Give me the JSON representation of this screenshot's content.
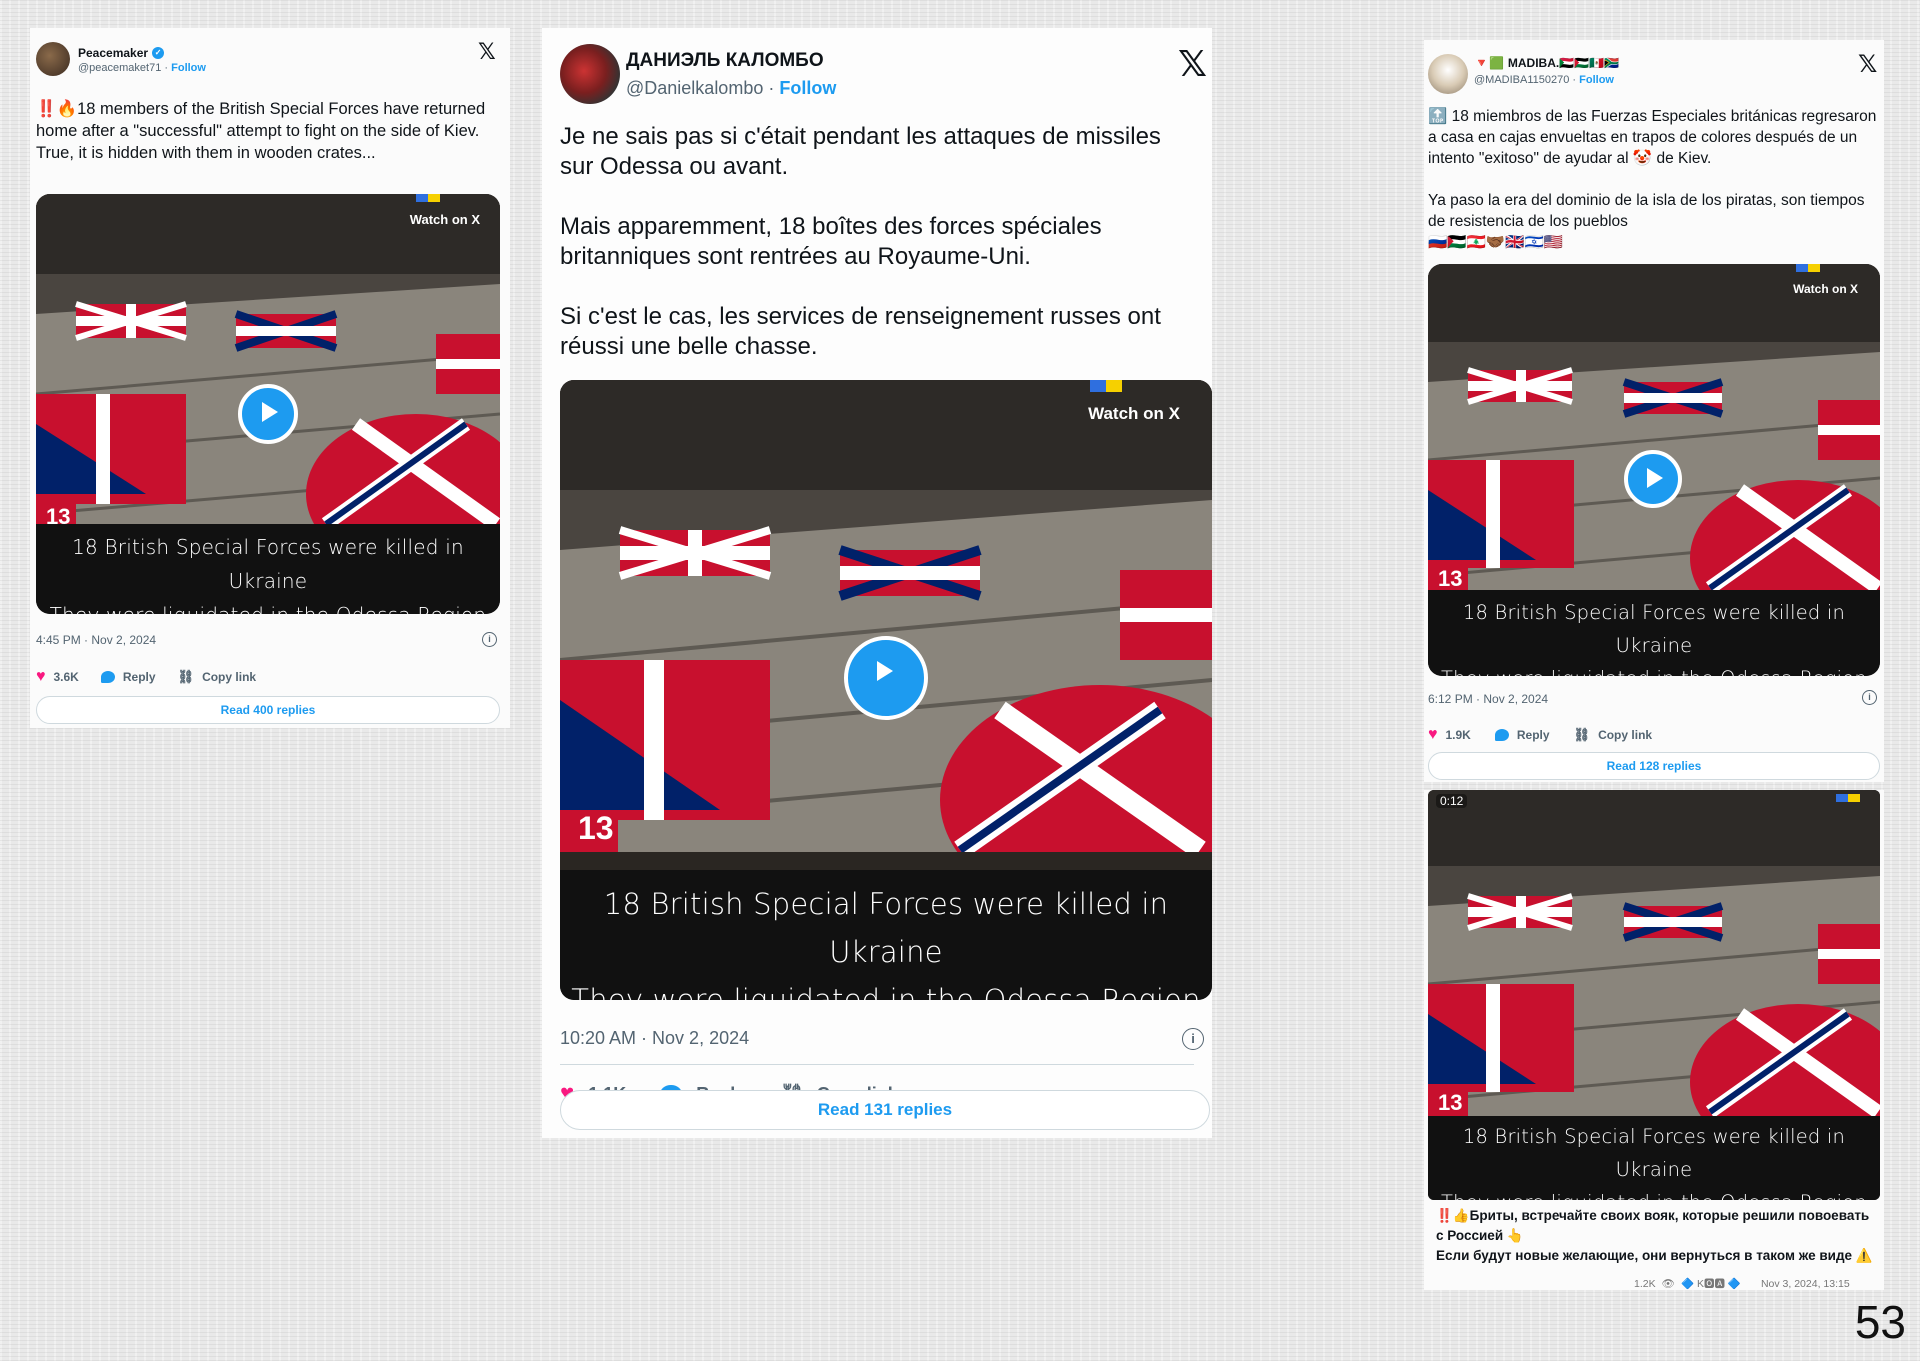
{
  "page_number": "53",
  "tweets": [
    {
      "name": "Peacemaker",
      "handle": "@peacemaket71",
      "follow_sep": "·",
      "follow": "Follow",
      "text": "‼️🔥18 members of the British Special Forces have returned home after a \"successful\" attempt to fight on the side of Kiev.\nTrue, it is hidden with them in wooden crates...",
      "watch": "Watch on X",
      "badge": "13",
      "caption_line1": "18 British Special Forces were killed in Ukraine",
      "caption_line2": "They were liquidated in the Odessa Region",
      "timestamp": "4:45 PM · Nov 2, 2024",
      "likes": "3.6K",
      "reply": "Reply",
      "copy": "Copy link",
      "read_replies": "Read 400 replies"
    },
    {
      "name": "ДАНИЭЛЬ КАЛОМБО",
      "handle": "@Danielkalombo",
      "follow_sep": "·",
      "follow": "Follow",
      "text": "Je ne sais pas si c'était pendant les attaques de missiles sur Odessa ou avant.\n\nMais apparemment, 18 boîtes des forces spéciales britanniques sont rentrées au Royaume-Uni.\n\nSi c'est le cas, les services de renseignement russes ont réussi une belle chasse.",
      "watch": "Watch on X",
      "badge": "13",
      "caption_line1": "18 British Special Forces were killed in Ukraine",
      "caption_line2": "They were liquidated in the Odessa Region",
      "timestamp": "10:20 AM · Nov 2, 2024",
      "likes": "1.1K",
      "reply": "Reply",
      "copy": "Copy link",
      "read_replies": "Read 131 replies"
    },
    {
      "name": "MADIBA.🇸🇩🇵🇸🇲🇽🇿🇦",
      "name_prefix": "🔻🟩",
      "handle": "@MADIBA1150270",
      "follow_sep": "·",
      "follow": "Follow",
      "text": "🔝 18 miembros de las Fuerzas Especiales británicas regresaron a casa en cajas envueltas en trapos de colores después de un intento \"exitoso\" de ayudar al 🤡 de Kiev.\n\nYa paso la era del dominio de la isla de los piratas, son tiempos de resistencia de los pueblos\n🇷🇺🇵🇸🇱🇧🤝🏾🇬🇧🇮🇱🇺🇸",
      "watch": "Watch on X",
      "badge": "13",
      "caption_line1": "18 British Special Forces were killed in Ukraine",
      "caption_line2": "They were liquidated in the Odessa Region",
      "timestamp": "6:12 PM · Nov 2, 2024",
      "likes": "1.9K",
      "reply": "Reply",
      "copy": "Copy link",
      "read_replies": "Read 128 replies"
    }
  ],
  "telegram": {
    "duration": "0:12",
    "badge": "13",
    "caption_line1": "18 British Special Forces were killed in Ukraine",
    "caption_line2": "They were liquidated in the Odessa Region",
    "text": "‼️👍Бриты, встречайте своих вояк, которые решили повоевать с Россией 👆\nЕсли будут новые желающие, они вернуться в таком же виде ⚠️",
    "views": "1.2K",
    "signature": "🔷 K🅾🅰 🔷",
    "date": "Nov 3, 2024, 13:15"
  },
  "icons": {
    "x_logo": "𝕏",
    "info": "i",
    "heart": "♥",
    "copy": "⛓",
    "eye": "👁"
  },
  "colors": {
    "accent": "#1d9bf0",
    "like": "#f91880",
    "muted": "#536471"
  }
}
